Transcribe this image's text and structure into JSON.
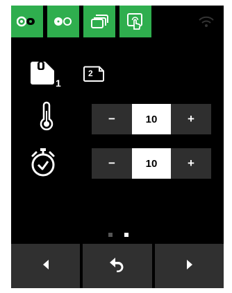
{
  "tabs": [
    {
      "icon": "ribbon-cassette-icon"
    },
    {
      "icon": "tape-reels-icon"
    },
    {
      "icon": "stacked-pages-icon"
    },
    {
      "icon": "touch-card-icon"
    },
    {
      "icon": "wifi-icon"
    }
  ],
  "media": {
    "slot1_label": "1",
    "slot2_label": "2"
  },
  "temperature": {
    "icon": "thermometer-icon",
    "minus": "−",
    "value": "10",
    "plus": "+"
  },
  "timer": {
    "icon": "stopwatch-icon",
    "minus": "−",
    "value": "10",
    "plus": "+"
  },
  "pager": {
    "pages": 2,
    "active": 2
  },
  "bottom_nav": [
    {
      "icon": "arrow-left-icon"
    },
    {
      "icon": "undo-icon"
    },
    {
      "icon": "arrow-right-icon"
    }
  ],
  "colors": {
    "accent": "#2fae4e",
    "panel": "#000000",
    "button": "#2f2f2f",
    "dot_inactive": "#555555",
    "dot_active": "#ffffff"
  }
}
